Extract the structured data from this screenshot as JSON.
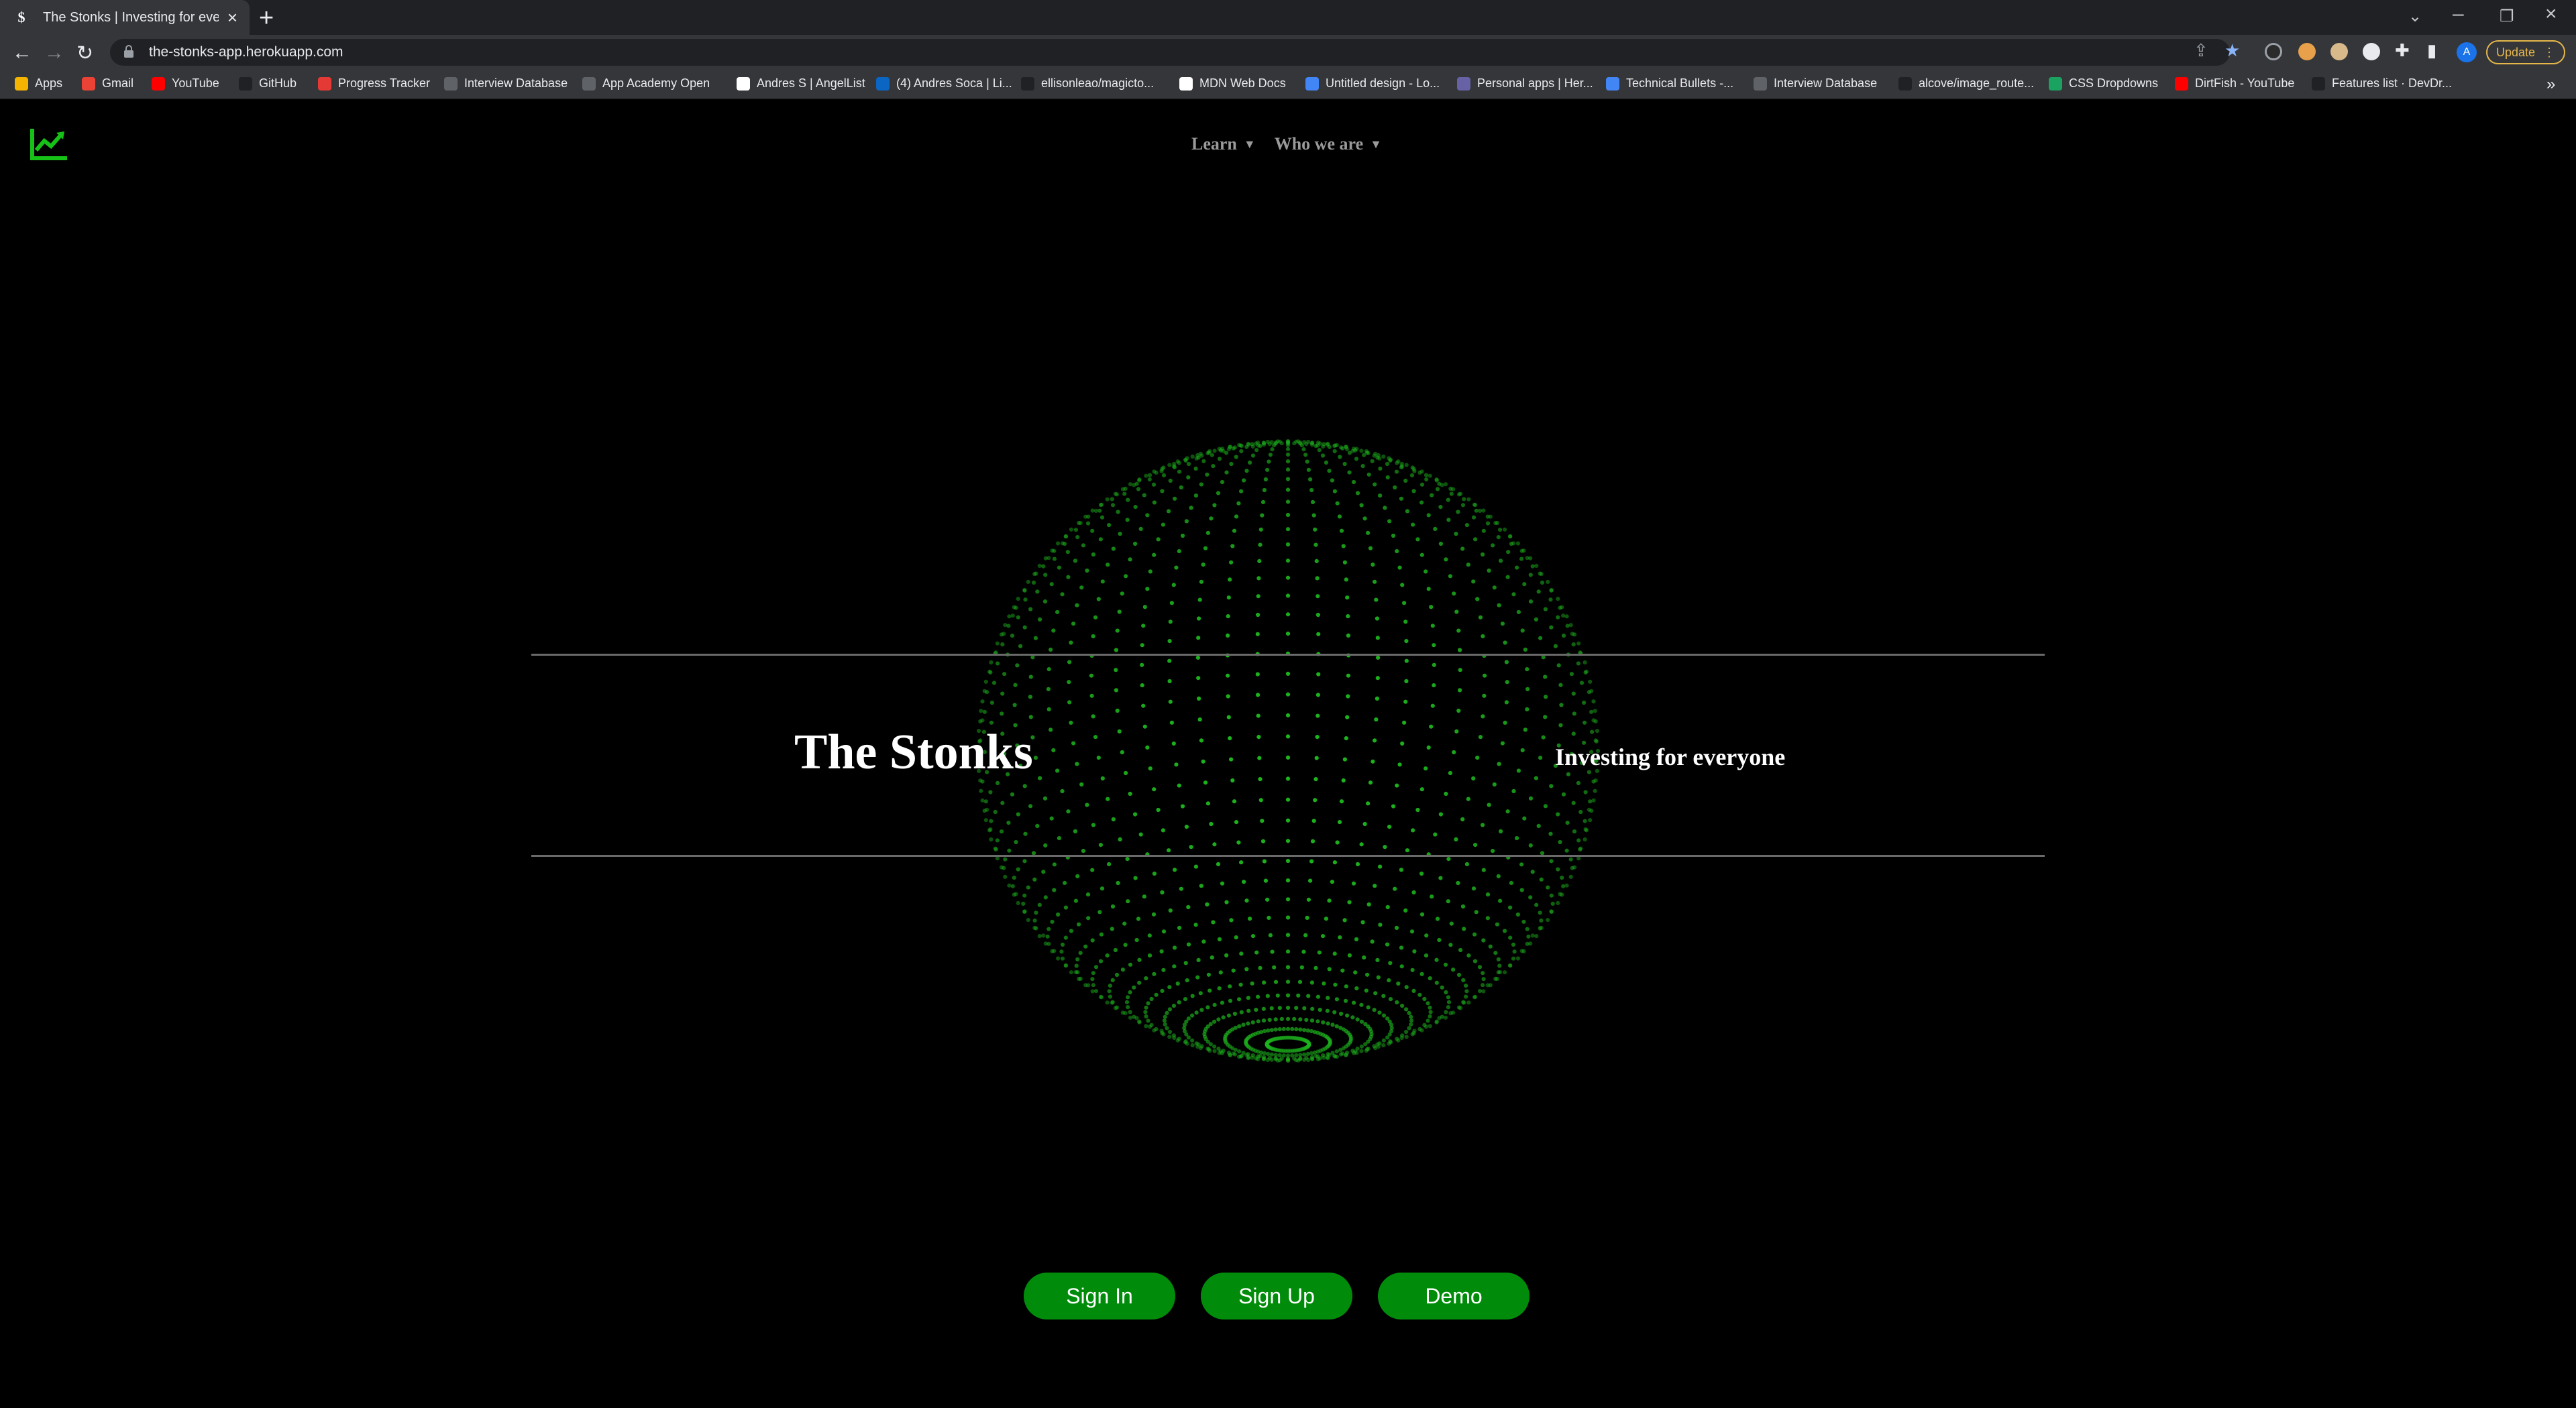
{
  "browser": {
    "tab_title": "The Stonks | Investing for everyone",
    "tab_favicon": "$",
    "url": "the-stonks-app.herokuapp.com",
    "update_label": "Update",
    "profile_initial": "A",
    "bookmarks": [
      {
        "label": "Apps",
        "color": "#f4b400"
      },
      {
        "label": "Gmail",
        "color": "#ea4335"
      },
      {
        "label": "YouTube",
        "color": "#ff0000"
      },
      {
        "label": "GitHub",
        "color": "#202124"
      },
      {
        "label": "Progress Tracker",
        "color": "#e53935"
      },
      {
        "label": "Interview Database",
        "color": "#5f6368"
      },
      {
        "label": "App Academy Open",
        "color": "#5f6368"
      },
      {
        "label": "Andres S | AngelList",
        "color": "#ffffff"
      },
      {
        "label": "(4) Andres Soca | Li...",
        "color": "#0a66c2"
      },
      {
        "label": "ellisonleao/magicto...",
        "color": "#202124"
      },
      {
        "label": "MDN Web Docs",
        "color": "#ffffff"
      },
      {
        "label": "Untitled design - Lo...",
        "color": "#4285f4"
      },
      {
        "label": "Personal apps | Her...",
        "color": "#6762a6"
      },
      {
        "label": "Technical Bullets -...",
        "color": "#4285f4"
      },
      {
        "label": "Interview Database",
        "color": "#5f6368"
      },
      {
        "label": "alcove/image_route...",
        "color": "#202124"
      },
      {
        "label": "CSS Dropdowns",
        "color": "#1aa260"
      },
      {
        "label": "DirtFish - YouTube",
        "color": "#ff0000"
      },
      {
        "label": "Features list · DevDr...",
        "color": "#202124"
      }
    ]
  },
  "nav": {
    "learn_label": "Learn",
    "who_label": "Who we are"
  },
  "hero": {
    "title": "The Stonks",
    "subtitle": "Investing for everyone"
  },
  "buttons": {
    "sign_in": "Sign In",
    "sign_up": "Sign Up",
    "demo": "Demo"
  },
  "colors": {
    "accent": "#008c0a",
    "sphere_dots": "#1db51d",
    "logo": "#17c217"
  }
}
